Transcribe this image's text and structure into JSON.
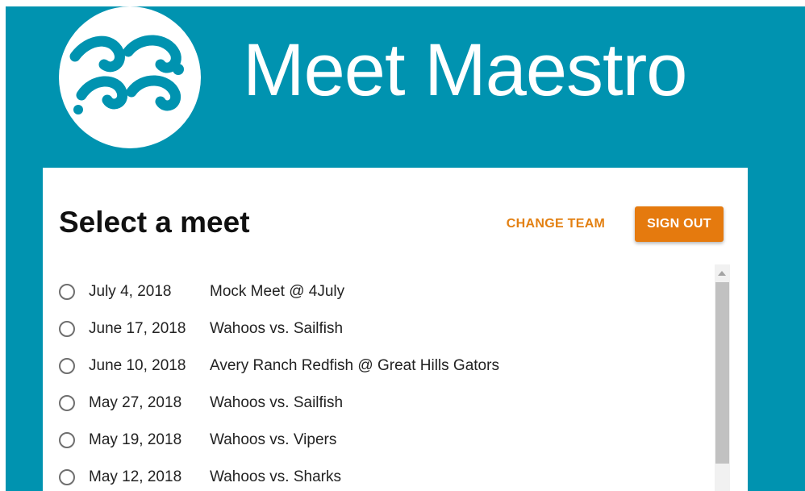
{
  "header": {
    "brand_name": "Meet Maestro",
    "logo_icon": "wave-logo-icon"
  },
  "colors": {
    "header_bg": "#0093b0",
    "accent_orange": "#e57a0e",
    "text_dark": "#111111"
  },
  "card": {
    "title": "Select a meet",
    "change_team_label": "CHANGE TEAM",
    "sign_out_label": "SIGN OUT"
  },
  "meets": [
    {
      "date": "July 4, 2018",
      "name": "Mock Meet @ 4July"
    },
    {
      "date": "June 17, 2018",
      "name": "Wahoos vs. Sailfish"
    },
    {
      "date": "June 10, 2018",
      "name": "Avery Ranch Redfish @ Great Hills Gators"
    },
    {
      "date": "May 27, 2018",
      "name": "Wahoos vs. Sailfish"
    },
    {
      "date": "May 19, 2018",
      "name": "Wahoos vs. Vipers"
    },
    {
      "date": "May 12, 2018",
      "name": "Wahoos vs. Sharks"
    }
  ]
}
